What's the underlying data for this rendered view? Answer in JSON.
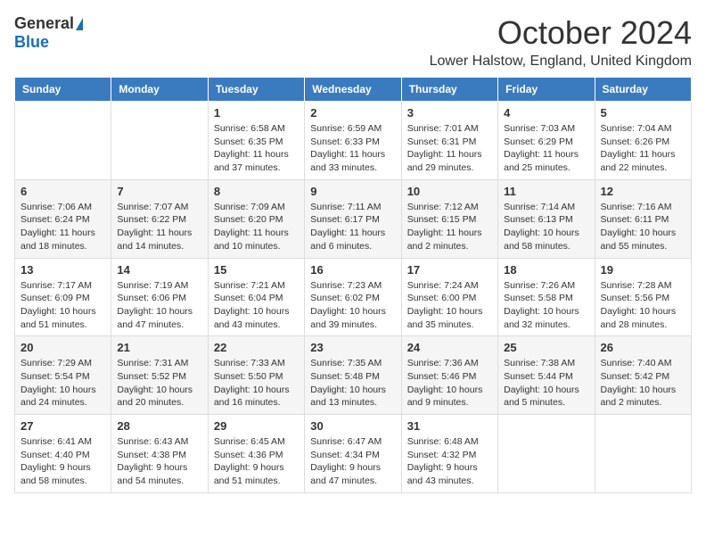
{
  "logo": {
    "general": "General",
    "blue": "Blue"
  },
  "title": "October 2024",
  "location": "Lower Halstow, England, United Kingdom",
  "days_of_week": [
    "Sunday",
    "Monday",
    "Tuesday",
    "Wednesday",
    "Thursday",
    "Friday",
    "Saturday"
  ],
  "weeks": [
    [
      {
        "day": "",
        "content": ""
      },
      {
        "day": "",
        "content": ""
      },
      {
        "day": "1",
        "content": "Sunrise: 6:58 AM\nSunset: 6:35 PM\nDaylight: 11 hours and 37 minutes."
      },
      {
        "day": "2",
        "content": "Sunrise: 6:59 AM\nSunset: 6:33 PM\nDaylight: 11 hours and 33 minutes."
      },
      {
        "day": "3",
        "content": "Sunrise: 7:01 AM\nSunset: 6:31 PM\nDaylight: 11 hours and 29 minutes."
      },
      {
        "day": "4",
        "content": "Sunrise: 7:03 AM\nSunset: 6:29 PM\nDaylight: 11 hours and 25 minutes."
      },
      {
        "day": "5",
        "content": "Sunrise: 7:04 AM\nSunset: 6:26 PM\nDaylight: 11 hours and 22 minutes."
      }
    ],
    [
      {
        "day": "6",
        "content": "Sunrise: 7:06 AM\nSunset: 6:24 PM\nDaylight: 11 hours and 18 minutes."
      },
      {
        "day": "7",
        "content": "Sunrise: 7:07 AM\nSunset: 6:22 PM\nDaylight: 11 hours and 14 minutes."
      },
      {
        "day": "8",
        "content": "Sunrise: 7:09 AM\nSunset: 6:20 PM\nDaylight: 11 hours and 10 minutes."
      },
      {
        "day": "9",
        "content": "Sunrise: 7:11 AM\nSunset: 6:17 PM\nDaylight: 11 hours and 6 minutes."
      },
      {
        "day": "10",
        "content": "Sunrise: 7:12 AM\nSunset: 6:15 PM\nDaylight: 11 hours and 2 minutes."
      },
      {
        "day": "11",
        "content": "Sunrise: 7:14 AM\nSunset: 6:13 PM\nDaylight: 10 hours and 58 minutes."
      },
      {
        "day": "12",
        "content": "Sunrise: 7:16 AM\nSunset: 6:11 PM\nDaylight: 10 hours and 55 minutes."
      }
    ],
    [
      {
        "day": "13",
        "content": "Sunrise: 7:17 AM\nSunset: 6:09 PM\nDaylight: 10 hours and 51 minutes."
      },
      {
        "day": "14",
        "content": "Sunrise: 7:19 AM\nSunset: 6:06 PM\nDaylight: 10 hours and 47 minutes."
      },
      {
        "day": "15",
        "content": "Sunrise: 7:21 AM\nSunset: 6:04 PM\nDaylight: 10 hours and 43 minutes."
      },
      {
        "day": "16",
        "content": "Sunrise: 7:23 AM\nSunset: 6:02 PM\nDaylight: 10 hours and 39 minutes."
      },
      {
        "day": "17",
        "content": "Sunrise: 7:24 AM\nSunset: 6:00 PM\nDaylight: 10 hours and 35 minutes."
      },
      {
        "day": "18",
        "content": "Sunrise: 7:26 AM\nSunset: 5:58 PM\nDaylight: 10 hours and 32 minutes."
      },
      {
        "day": "19",
        "content": "Sunrise: 7:28 AM\nSunset: 5:56 PM\nDaylight: 10 hours and 28 minutes."
      }
    ],
    [
      {
        "day": "20",
        "content": "Sunrise: 7:29 AM\nSunset: 5:54 PM\nDaylight: 10 hours and 24 minutes."
      },
      {
        "day": "21",
        "content": "Sunrise: 7:31 AM\nSunset: 5:52 PM\nDaylight: 10 hours and 20 minutes."
      },
      {
        "day": "22",
        "content": "Sunrise: 7:33 AM\nSunset: 5:50 PM\nDaylight: 10 hours and 16 minutes."
      },
      {
        "day": "23",
        "content": "Sunrise: 7:35 AM\nSunset: 5:48 PM\nDaylight: 10 hours and 13 minutes."
      },
      {
        "day": "24",
        "content": "Sunrise: 7:36 AM\nSunset: 5:46 PM\nDaylight: 10 hours and 9 minutes."
      },
      {
        "day": "25",
        "content": "Sunrise: 7:38 AM\nSunset: 5:44 PM\nDaylight: 10 hours and 5 minutes."
      },
      {
        "day": "26",
        "content": "Sunrise: 7:40 AM\nSunset: 5:42 PM\nDaylight: 10 hours and 2 minutes."
      }
    ],
    [
      {
        "day": "27",
        "content": "Sunrise: 6:41 AM\nSunset: 4:40 PM\nDaylight: 9 hours and 58 minutes."
      },
      {
        "day": "28",
        "content": "Sunrise: 6:43 AM\nSunset: 4:38 PM\nDaylight: 9 hours and 54 minutes."
      },
      {
        "day": "29",
        "content": "Sunrise: 6:45 AM\nSunset: 4:36 PM\nDaylight: 9 hours and 51 minutes."
      },
      {
        "day": "30",
        "content": "Sunrise: 6:47 AM\nSunset: 4:34 PM\nDaylight: 9 hours and 47 minutes."
      },
      {
        "day": "31",
        "content": "Sunrise: 6:48 AM\nSunset: 4:32 PM\nDaylight: 9 hours and 43 minutes."
      },
      {
        "day": "",
        "content": ""
      },
      {
        "day": "",
        "content": ""
      }
    ]
  ]
}
